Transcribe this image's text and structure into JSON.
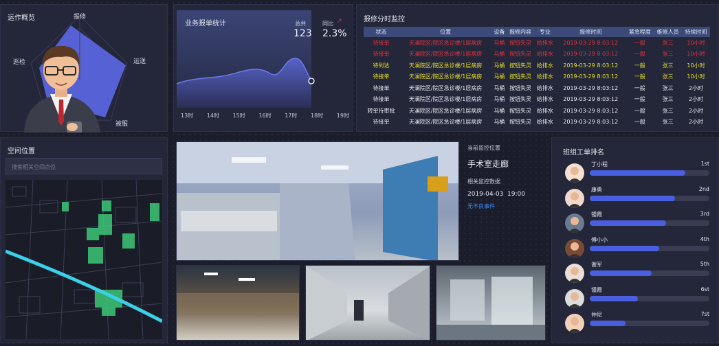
{
  "overview": {
    "title": "运作概览",
    "axes": [
      "报修",
      "运送",
      "被服",
      "巡检"
    ]
  },
  "stats": {
    "title": "业务报单统计",
    "total_label": "总共",
    "total_value": "123",
    "yoy_label": "同比",
    "yoy_value": "2.3%",
    "x_ticks": [
      "13时",
      "14时",
      "15时",
      "16时",
      "17时",
      "18时",
      "19时"
    ]
  },
  "monitor": {
    "title": "报修分时监控",
    "columns": [
      "状态",
      "位置",
      "设备",
      "报修内容",
      "专业",
      "报修时间",
      "紧急程度",
      "维修人员",
      "持续时间"
    ],
    "rows": [
      {
        "cells": [
          "待接单",
          "天澜院区/院区急诊楼/1层病房",
          "马桶",
          "按钮失灵",
          "给排水",
          "2019-03-29 8:03:12",
          "一般",
          "张三",
          "10小时"
        ],
        "color": "#e0323e"
      },
      {
        "cells": [
          "待接单",
          "天澜院区/院区急诊楼/1层病房",
          "马桶",
          "按钮失灵",
          "给排水",
          "2019-03-29 8:03:12",
          "一般",
          "张三",
          "10小时"
        ],
        "color": "#e0323e"
      },
      {
        "cells": [
          "待到达",
          "天澜院区/院区急诊楼/1层病房",
          "马桶",
          "按钮失灵",
          "给排水",
          "2019-03-29 8:03:12",
          "一般",
          "张三",
          "10小时"
        ],
        "color": "#e6df2a"
      },
      {
        "cells": [
          "待接单",
          "天澜院区/院区急诊楼/1层病房",
          "马桶",
          "按钮失灵",
          "给排水",
          "2019-03-29 8:03:12",
          "一般",
          "张三",
          "10小时"
        ],
        "color": "#e6df2a"
      },
      {
        "cells": [
          "待接单",
          "天澜院区/院区急诊楼/1层病房",
          "马桶",
          "按钮失灵",
          "给排水",
          "2019-03-29 8:03:12",
          "一般",
          "张三",
          "2小时"
        ],
        "color": "#e8eaf2"
      },
      {
        "cells": [
          "待接单",
          "天澜院区/院区急诊楼/1层病房",
          "马桶",
          "按钮失灵",
          "给排水",
          "2019-03-29 8:03:12",
          "一般",
          "张三",
          "2小时"
        ],
        "color": "#e8eaf2"
      },
      {
        "cells": [
          "转单待审批",
          "天澜院区/院区急诊楼/1层病房",
          "马桶",
          "按钮失灵",
          "给排水",
          "2019-03-29 8:03:12",
          "一般",
          "张三",
          "2小时"
        ],
        "color": "#e8eaf2"
      },
      {
        "cells": [
          "待接单",
          "天澜院区/院区急诊楼/1层病房",
          "马桶",
          "按钮失灵",
          "给排水",
          "2019-03-29 8:03:12",
          "一般",
          "张三",
          "2小时"
        ],
        "color": "#e8eaf2"
      }
    ]
  },
  "space": {
    "title": "空间位置",
    "search_placeholder": "搜索相关空间点位"
  },
  "current": {
    "title": "当前监控位置",
    "location": "手术室走廊",
    "data_label": "相关监控数据",
    "datetime": "2019-04-03  19:00",
    "event": "无不良事件"
  },
  "ranking": {
    "title": "班组工单排名",
    "items": [
      {
        "name": "丁小程",
        "pos": "1st",
        "level": 0.8
      },
      {
        "name": "康勇",
        "pos": "2nd",
        "level": 0.71
      },
      {
        "name": "锺霞",
        "pos": "3rd",
        "level": 0.64
      },
      {
        "name": "傅小小",
        "pos": "4th",
        "level": 0.58
      },
      {
        "name": "谢军",
        "pos": "5th",
        "level": 0.52
      },
      {
        "name": "锺霞",
        "pos": "6st",
        "level": 0.4
      },
      {
        "name": "仲尼",
        "pos": "7st",
        "level": 0.3
      }
    ]
  },
  "colors": {
    "accent": "#4a5ee0",
    "panel": "#24273a",
    "header": "#3b4a78",
    "red": "#e0323e",
    "yellow": "#e6df2a"
  }
}
